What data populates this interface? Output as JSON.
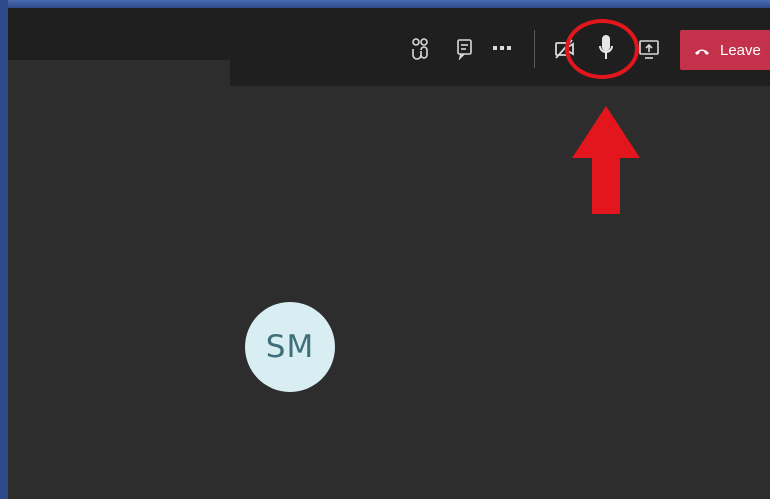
{
  "toolbar": {
    "participants_icon": "participants-icon",
    "chat_icon": "chat-icon",
    "more_icon": "more-options-icon",
    "camera_icon": "camera-off-icon",
    "mic_icon": "microphone-icon",
    "share_icon": "share-screen-icon",
    "leave_icon": "phone-hangup-icon",
    "leave_label": "Leave"
  },
  "annotation": {
    "highlight_color": "#e3161d",
    "target": "microphone-icon"
  },
  "participant": {
    "initials": "SM"
  },
  "colors": {
    "stage": "#2d2d2d",
    "toolbar": "#1f1f1f",
    "leave": "#c4314b",
    "avatar_bg": "#d9eef2",
    "avatar_text": "#3f6f78"
  }
}
